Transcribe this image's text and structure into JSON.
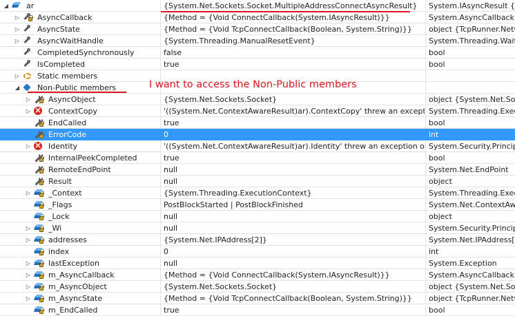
{
  "annotation": {
    "text": "I want to access the Non-Public members"
  },
  "rows": [
    {
      "indent": 0,
      "expander": "down",
      "icon": "field",
      "lock": false,
      "name": "ar",
      "value": "{System.Net.Sockets.Socket.MultipleAddressConnectAsyncResult}",
      "type": "System.IAsyncResult {Sys"
    },
    {
      "indent": 1,
      "expander": "right",
      "icon": "prop",
      "lock": true,
      "name": "AsyncCallback",
      "value": "{Method = {Void ConnectCallback(System.IAsyncResult)}}",
      "type": "System.AsyncCallback"
    },
    {
      "indent": 1,
      "expander": "right",
      "icon": "prop",
      "lock": false,
      "name": "AsyncState",
      "value": "{Method = {Void TcpConnectCallback(Boolean, System.String)}}",
      "type": "object {TcpRunner.Netw"
    },
    {
      "indent": 1,
      "expander": "right",
      "icon": "prop",
      "lock": false,
      "name": "AsyncWaitHandle",
      "value": "{System.Threading.ManualResetEvent}",
      "type": "System.Threading.WaitH"
    },
    {
      "indent": 1,
      "expander": "",
      "icon": "prop",
      "lock": false,
      "name": "CompletedSynchronously",
      "value": "false",
      "type": "bool"
    },
    {
      "indent": 1,
      "expander": "",
      "icon": "prop",
      "lock": false,
      "name": "IsCompleted",
      "value": "true",
      "type": "bool"
    },
    {
      "indent": 1,
      "expander": "right",
      "icon": "static",
      "lock": false,
      "name": "Static members",
      "value": "",
      "type": ""
    },
    {
      "indent": 1,
      "expander": "down",
      "icon": "np",
      "lock": false,
      "name": "Non-Public members",
      "value": "",
      "type": ""
    },
    {
      "indent": 2,
      "expander": "right",
      "icon": "wrench",
      "lock": true,
      "name": "AsyncObject",
      "value": "{System.Net.Sockets.Socket}",
      "type": "object {System.Net.Sock"
    },
    {
      "indent": 2,
      "expander": "right",
      "icon": "err",
      "lock": false,
      "name": "ContextCopy",
      "value": "'((System.Net.ContextAwareResult)ar).ContextCopy' threw an exception",
      "type": "System.Threading.Execu"
    },
    {
      "indent": 2,
      "expander": "",
      "icon": "wrench",
      "lock": true,
      "name": "EndCalled",
      "value": "true",
      "type": "bool"
    },
    {
      "indent": 2,
      "expander": "",
      "icon": "wrench",
      "lock": true,
      "name": "ErrorCode",
      "value": "0",
      "type": "int",
      "selected": true
    },
    {
      "indent": 2,
      "expander": "right",
      "icon": "err",
      "lock": false,
      "name": "Identity",
      "value": "'((System.Net.ContextAwareResult)ar).Identity' threw an exception of typ",
      "type": "System.Security.Principa"
    },
    {
      "indent": 2,
      "expander": "",
      "icon": "wrench",
      "lock": true,
      "name": "InternalPeekCompleted",
      "value": "true",
      "type": "bool"
    },
    {
      "indent": 2,
      "expander": "",
      "icon": "wrench",
      "lock": true,
      "name": "RemoteEndPoint",
      "value": "null",
      "type": "System.Net.EndPoint"
    },
    {
      "indent": 2,
      "expander": "",
      "icon": "wrench",
      "lock": true,
      "name": "Result",
      "value": "null",
      "type": "object"
    },
    {
      "indent": 2,
      "expander": "right",
      "icon": "field",
      "lock": true,
      "name": "_Context",
      "value": "{System.Threading.ExecutionContext}",
      "type": "System.Threading.Execu"
    },
    {
      "indent": 2,
      "expander": "",
      "icon": "field",
      "lock": true,
      "name": "_Flags",
      "value": "PostBlockStarted | PostBlockFinished",
      "type": "System.Net.ContextAwa"
    },
    {
      "indent": 2,
      "expander": "",
      "icon": "field",
      "lock": true,
      "name": "_Lock",
      "value": "null",
      "type": "object"
    },
    {
      "indent": 2,
      "expander": "right",
      "icon": "field",
      "lock": true,
      "name": "_Wi",
      "value": "null",
      "type": "System.Security.Principa"
    },
    {
      "indent": 2,
      "expander": "right",
      "icon": "field",
      "lock": true,
      "name": "addresses",
      "value": "{System.Net.IPAddress[2]}",
      "type": "System.Net.IPAddress[]"
    },
    {
      "indent": 2,
      "expander": "",
      "icon": "field",
      "lock": true,
      "name": "index",
      "value": "0",
      "type": "int"
    },
    {
      "indent": 2,
      "expander": "right",
      "icon": "field",
      "lock": true,
      "name": "lastException",
      "value": "null",
      "type": "System.Exception"
    },
    {
      "indent": 2,
      "expander": "right",
      "icon": "field",
      "lock": true,
      "name": "m_AsyncCallback",
      "value": "{Method = {Void ConnectCallback(System.IAsyncResult)}}",
      "type": "System.AsyncCallback"
    },
    {
      "indent": 2,
      "expander": "right",
      "icon": "field",
      "lock": true,
      "name": "m_AsyncObject",
      "value": "{System.Net.Sockets.Socket}",
      "type": "object {System.Net.Sock"
    },
    {
      "indent": 2,
      "expander": "right",
      "icon": "field",
      "lock": true,
      "name": "m_AsyncState",
      "value": "{Method = {Void TcpConnectCallback(Boolean, System.String)}}",
      "type": "object {TcpRunner.Netw"
    },
    {
      "indent": 2,
      "expander": "",
      "icon": "field",
      "lock": true,
      "name": "m_EndCalled",
      "value": "true",
      "type": "bool"
    }
  ]
}
